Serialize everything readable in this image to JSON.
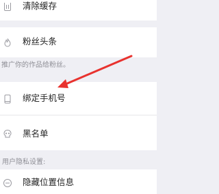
{
  "settings": {
    "clear_cache": "清除缓存",
    "fans_headline": "粉丝头条",
    "fans_headline_desc": "推广你的作品给粉丝。",
    "bind_phone": "绑定手机号",
    "blacklist": "黑名单",
    "privacy_header": "用户隐私设置:",
    "hide_location": "隐藏位置信息"
  },
  "annotation": {
    "arrow_color": "#e8322e"
  }
}
